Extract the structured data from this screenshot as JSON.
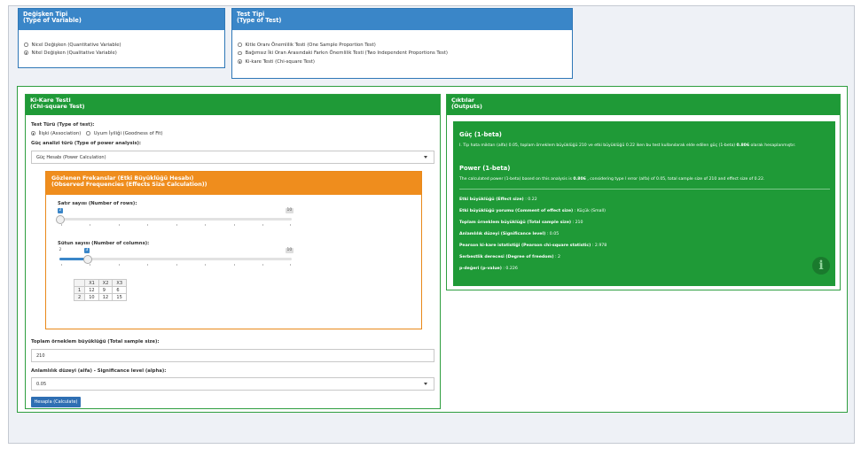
{
  "variable_type": {
    "title": "Değişken Tipi\n(Type of Variable)",
    "options": [
      {
        "label": "Nicel Değişken (Quantitative Variable)",
        "selected": false
      },
      {
        "label": "Nitel Değişken (Qualitative Variable)",
        "selected": true
      }
    ]
  },
  "test_type": {
    "title": "Test Tipi\n(Type of Test)",
    "options": [
      {
        "label": "Kitle Oranı Önemlilik Testi (One Sample Proportion Test)",
        "selected": false
      },
      {
        "label": "Bağımsız İki Oran Arasındaki Farkın Önemlilik Testi (Two Independent Proportions Test)",
        "selected": false
      },
      {
        "label": "Ki-kare Testi (Chi-square Test)",
        "selected": true
      }
    ]
  },
  "chi_panel": {
    "title": "Ki-Kare Testi\n(Chi-square Test)",
    "test_kind_label": "Test Türü (Type of test):",
    "test_kind_options": [
      {
        "label": "İlişki (Association)",
        "selected": true
      },
      {
        "label": "Uyum İyiliği (Goodness of Fit)",
        "selected": false
      }
    ],
    "power_type_label": "Güç analizi türü (Type of power analysis):",
    "power_type_value": "Güç Hesabı (Power Calculation)",
    "observed": {
      "title": "Gözlenen Frekanslar (Etki Büyüklüğü Hesabı)\n(Observed Frequencies (Effects Size Calculation))",
      "rows_label": "Satır sayısı (Number of rows):",
      "rows_value": "2",
      "rows_max": "10",
      "cols_label": "Sütun sayısı (Number of columns):",
      "cols_value": "3",
      "cols_min": "2",
      "cols_max": "10",
      "table_headers": [
        "X1",
        "X2",
        "X3"
      ],
      "table_rows": [
        [
          "1",
          "12",
          "9",
          "6"
        ],
        [
          "2",
          "10",
          "12",
          "15"
        ]
      ]
    },
    "sample_size_label": "Toplam örneklem büyüklüğü (Total sample size):",
    "sample_size_value": "210",
    "alpha_label": "Anlamlılık düzeyi (alfa) - Significance level (alpha):",
    "alpha_value": "0.05",
    "calculate_label": "Hesapla (Calculate)"
  },
  "outputs": {
    "title": "Çıktılar\n(Outputs)",
    "tr_title": "Güç (1-beta)",
    "tr_text_pre": "I. Tip hata miktarı (alfa) 0.05, toplam örneklem büyüklüğü 210 ve etki büyüklüğü 0.22 iken bu test kullanılarak elde edilen güç (1-beta) ",
    "tr_text_bold": "0.806",
    "tr_text_post": " olarak hesaplanmıştır.",
    "en_title": "Power (1-beta)",
    "en_text_pre": "The calculated power (1-beta) based on this analysis is ",
    "en_text_bold": "0.806",
    "en_text_post": " , considering type I error (alfa) of 0.05, total sample size of 210 and effect size of 0.22.",
    "items": [
      {
        "k": "Etki büyüklüğü (Effect size)",
        "v": " : 0.22"
      },
      {
        "k": "Etki büyüklüğü yorumu (Comment of effect size)",
        "v": " : Küçük (Small)"
      },
      {
        "k": "Toplam örneklem büyüklüğü (Total sample size)",
        "v": " : 210"
      },
      {
        "k": "Anlamlılık düzeyi (Significance level)",
        "v": " : 0.05"
      },
      {
        "k": "Pearson ki-kare istatistiği (Pearson chi-square statistic)",
        "v": " : 2.978"
      },
      {
        "k": "Serbestlik derecesi (Degree of freedom)",
        "v": " : 2"
      },
      {
        "k": "p-değeri (p-value)",
        "v": " : 0.226"
      }
    ],
    "info_glyph": "i"
  },
  "colors": {
    "blue_header": "#3a86c8",
    "green_header": "#1f9a37",
    "orange_header": "#ef8d1d",
    "button": "#2f6fb3"
  }
}
